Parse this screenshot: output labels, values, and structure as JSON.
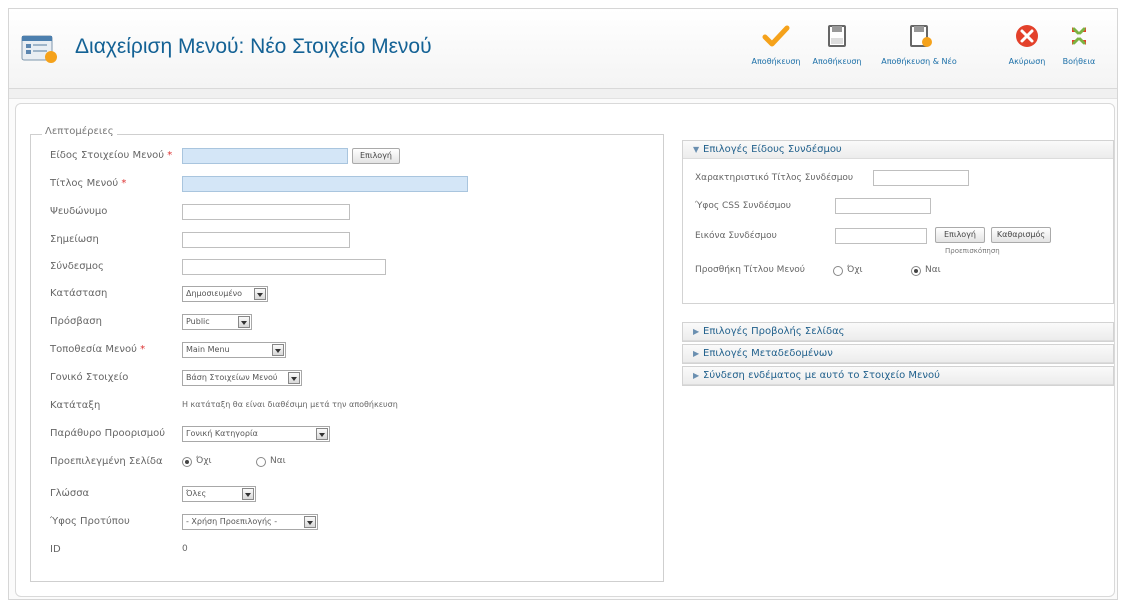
{
  "header": {
    "title": "Διαχείριση Μενού: Νέο Στοιχείο Μενού",
    "buttons": [
      {
        "label": "Αποθήκευση",
        "icon": "checkmark-icon"
      },
      {
        "label": "Αποθήκευση",
        "icon": "save-icon"
      },
      {
        "label": "Αποθήκευση & Νέο",
        "icon": "save-new-icon"
      },
      {
        "label": "Ακύρωση",
        "icon": "cancel-icon"
      },
      {
        "label": "Βοήθεια",
        "icon": "help-icon"
      }
    ]
  },
  "details": {
    "legend": "Λεπτομέρειες",
    "menu_item_type": {
      "label": "Είδος Στοιχείου Μενού",
      "value": "",
      "button": "Επιλογή"
    },
    "menu_title": {
      "label": "Τίτλος Μενού",
      "value": ""
    },
    "alias": {
      "label": "Ψευδώνυμο",
      "value": ""
    },
    "note": {
      "label": "Σημείωση",
      "value": ""
    },
    "link": {
      "label": "Σύνδεσμος",
      "value": ""
    },
    "status": {
      "label": "Κατάσταση",
      "value": "Δημοσιευμένο"
    },
    "access": {
      "label": "Πρόσβαση",
      "value": "Public"
    },
    "menu_location": {
      "label": "Τοποθεσία Μενού",
      "value": "Main Menu"
    },
    "parent_item": {
      "label": "Γονικό Στοιχείο",
      "value": "Βάση Στοιχείων Μενού"
    },
    "ordering": {
      "label": "Κατάταξη",
      "value": "Η κατάταξη θα είναι διαθέσιμη μετά την αποθήκευση"
    },
    "target_window": {
      "label": "Παράθυρο Προορισμού",
      "value": "Γονική Κατηγορία"
    },
    "default_page": {
      "label": "Προεπιλεγμένη Σελίδα",
      "options": [
        "Όχι",
        "Ναι"
      ],
      "selected": "Όχι"
    },
    "language": {
      "label": "Γλώσσα",
      "value": "Όλες"
    },
    "template_style": {
      "label": "Ύφος Προτύπου",
      "value": "- Χρήση Προεπιλογής -"
    },
    "id": {
      "label": "ID",
      "value": "0"
    }
  },
  "link_options": {
    "header": "Επιλογές Είδους Συνδέσμου",
    "title_attribute": {
      "label": "Χαρακτηριστικό Τίτλος Συνδέσμου",
      "value": ""
    },
    "css_style": {
      "label": "Ύφος CSS Συνδέσμου",
      "value": ""
    },
    "image": {
      "label": "Εικόνα Συνδέσμου",
      "value": "",
      "select_button": "Επιλογή",
      "clear_button": "Καθαρισμός",
      "preview_label": "Προεπισκόπηση"
    },
    "add_menu_title": {
      "label": "Προσθήκη Τίτλου Μενού",
      "options": [
        "Όχι",
        "Ναι"
      ],
      "selected": "Ναι"
    }
  },
  "page_display": {
    "header": "Επιλογές Προβολής Σελίδας"
  },
  "metadata": {
    "header": "Επιλογές Μεταδεδομένων"
  },
  "associations": {
    "header": "Σύνδεση ενδέματος με αυτό το Στοιχείο Μενού"
  },
  "colors": {
    "title_blue": "#146295",
    "accent_orange": "#f5a21b",
    "cancel_red": "#e3412b"
  }
}
